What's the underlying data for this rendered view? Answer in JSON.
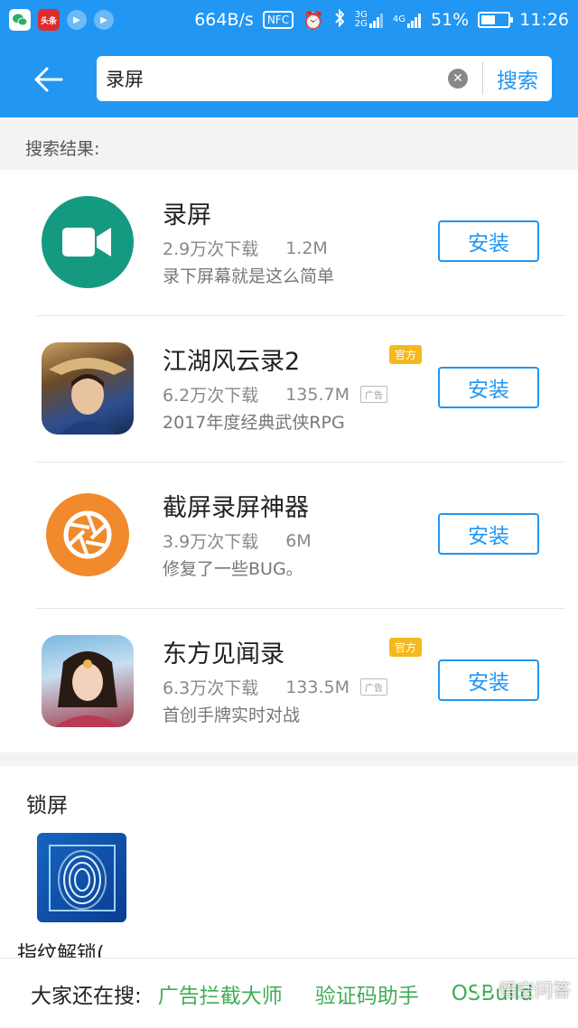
{
  "status_bar": {
    "net_speed": "664B/s",
    "nfc": "NFC",
    "sig1_top": "3G",
    "sig1_bottom": "2G",
    "sig2": "4G",
    "battery": "51%",
    "battery_level": 0.51,
    "time": "11:26",
    "toutiao": "头条"
  },
  "search": {
    "query": "录屏",
    "button_label": "搜索"
  },
  "results_label": "搜索结果:",
  "apps": [
    {
      "name": "录屏",
      "downloads": "2.9万次下载",
      "size": "1.2M",
      "desc": "录下屏幕就是这么简单",
      "official": "",
      "ad": "",
      "install": "安装",
      "icon": "video-camera-icon",
      "color": "#159a82"
    },
    {
      "name": "江湖风云录2",
      "downloads": "6.2万次下载",
      "size": "135.7M",
      "desc": "2017年度经典武侠RPG",
      "official": "官方",
      "ad": "广告",
      "install": "安装",
      "icon": "game-warrior-icon",
      "color": "#3a5b9a"
    },
    {
      "name": "截屏录屏神器",
      "downloads": "3.9万次下载",
      "size": "6M",
      "desc": "修复了一些BUG。",
      "official": "",
      "ad": "",
      "install": "安装",
      "icon": "aperture-icon",
      "color": "#f08a2c"
    },
    {
      "name": "东方见闻录",
      "downloads": "6.3万次下载",
      "size": "133.5M",
      "desc": "首创手牌实时对战",
      "official": "官方",
      "ad": "广告",
      "install": "安装",
      "icon": "game-heroine-icon",
      "color": "#a13a4a"
    }
  ],
  "lock_section": {
    "title": "锁屏",
    "app_name": "指纹解锁("
  },
  "bottom": {
    "label": "大家还在搜:",
    "hot_words": [
      "广告拦截大师",
      "验证码助手",
      "OSBuild"
    ]
  },
  "watermark": "悟空问答"
}
